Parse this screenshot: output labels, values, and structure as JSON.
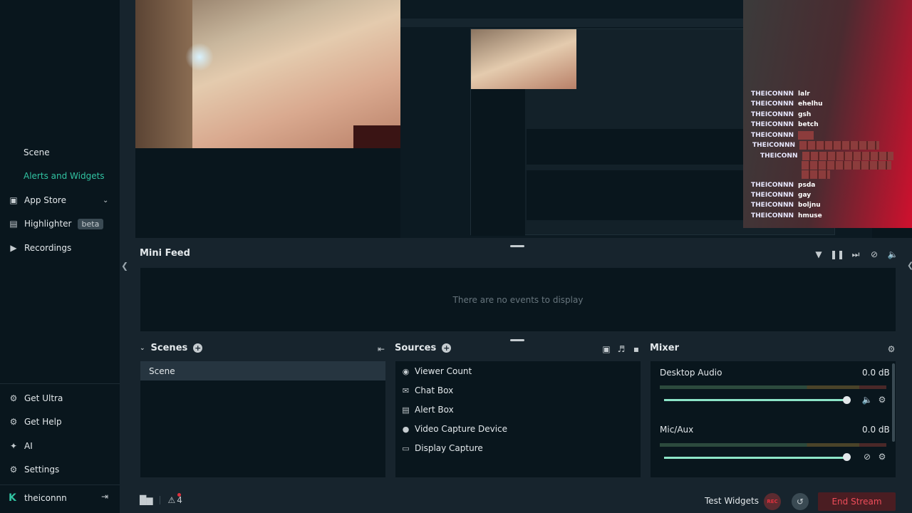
{
  "sidebar": {
    "items": [
      {
        "label": "Scene",
        "icon": "none"
      },
      {
        "label": "Alerts and Widgets",
        "icon": "none",
        "active": true
      },
      {
        "label": "App Store",
        "icon": "store-icon",
        "chevron": "chevron-down-icon"
      },
      {
        "label": "Highlighter",
        "icon": "highlighter-icon",
        "badge": "beta"
      },
      {
        "label": "Recordings",
        "icon": "play-circle-icon"
      }
    ],
    "bottom_items": [
      {
        "label": "Get Ultra",
        "icon": "ultra-icon"
      },
      {
        "label": "Get Help",
        "icon": "help-icon"
      },
      {
        "label": "AI",
        "icon": "sparkle-icon"
      },
      {
        "label": "Settings",
        "icon": "gear-icon"
      }
    ],
    "user": {
      "name": "theiconnn",
      "logo": "K"
    }
  },
  "chat": {
    "lines": [
      {
        "user": "THEICONNN",
        "msg": "lalr"
      },
      {
        "user": "THEICONNN",
        "msg": "ehelhu"
      },
      {
        "user": "THEICONNN",
        "msg": "gsh"
      },
      {
        "user": "THEICONNN",
        "msg": "betch"
      },
      {
        "user": "THEICONNN",
        "msg": ""
      },
      {
        "user": "THEICONNN",
        "msg": ""
      },
      {
        "user": "THEICONN",
        "msg": ""
      },
      {
        "user": "THEICONNN",
        "msg": "psda"
      },
      {
        "user": "THEICONNN",
        "msg": "gay"
      },
      {
        "user": "THEICONNN",
        "msg": "boljnu"
      },
      {
        "user": "THEICONNN",
        "msg": "hmuse"
      }
    ]
  },
  "minifeed": {
    "title": "Mini Feed",
    "empty_text": "There are no events to display"
  },
  "scenes": {
    "title": "Scenes",
    "items": [
      "Scene"
    ]
  },
  "sources": {
    "title": "Sources",
    "items": [
      {
        "label": "Viewer Count",
        "icon": "eye-icon"
      },
      {
        "label": "Chat Box",
        "icon": "chat-icon"
      },
      {
        "label": "Alert Box",
        "icon": "alert-box-icon"
      },
      {
        "label": "Video Capture Device",
        "icon": "webcam-icon"
      },
      {
        "label": "Display Capture",
        "icon": "monitor-icon"
      }
    ]
  },
  "mixer": {
    "title": "Mixer",
    "channels": [
      {
        "label": "Desktop Audio",
        "db": "0.0 dB",
        "level": 1.0,
        "muted": false
      },
      {
        "label": "Mic/Aux",
        "db": "0.0 dB",
        "level": 1.0,
        "muted": true
      }
    ]
  },
  "footer": {
    "notif_count": "4",
    "test_widgets": "Test Widgets",
    "rec_label": "REC",
    "end_stream": "End Stream"
  },
  "colors": {
    "accent": "#31c3a2",
    "end_stream": "#ef4d5a",
    "background": "#17242d",
    "panel": "#09161d"
  }
}
